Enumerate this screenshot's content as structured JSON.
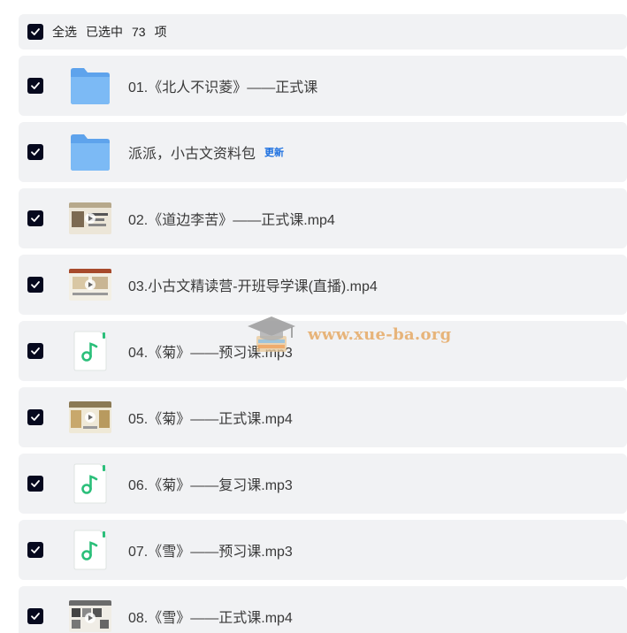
{
  "header": {
    "select_all": "全选",
    "selected_prefix": "已选中",
    "selected_count": "73",
    "selected_suffix": "项"
  },
  "items": [
    {
      "label": "01.《北人不识菱》——正式课",
      "type": "folder"
    },
    {
      "label": "派派，小古文资料包",
      "type": "folder",
      "badge": "更新"
    },
    {
      "label": "02.《道边李苦》——正式课.mp4",
      "type": "video"
    },
    {
      "label": "03.小古文精读营-开班导学课(直播).mp4",
      "type": "video"
    },
    {
      "label": "04.《菊》——预习课.mp3",
      "type": "audio"
    },
    {
      "label": "05.《菊》——正式课.mp4",
      "type": "video"
    },
    {
      "label": "06.《菊》——复习课.mp3",
      "type": "audio"
    },
    {
      "label": "07.《雪》——预习课.mp3",
      "type": "audio"
    },
    {
      "label": "08.《雪》——正式课.mp4",
      "type": "video"
    }
  ],
  "watermark": {
    "text": "www.xue-ba.org"
  },
  "colors": {
    "checkbox": "#06091e",
    "row_bg": "#f1f2f4",
    "folder": "#6aaef0",
    "audio_accent": "#2bbf7a",
    "badge": "#1b6fe0"
  }
}
